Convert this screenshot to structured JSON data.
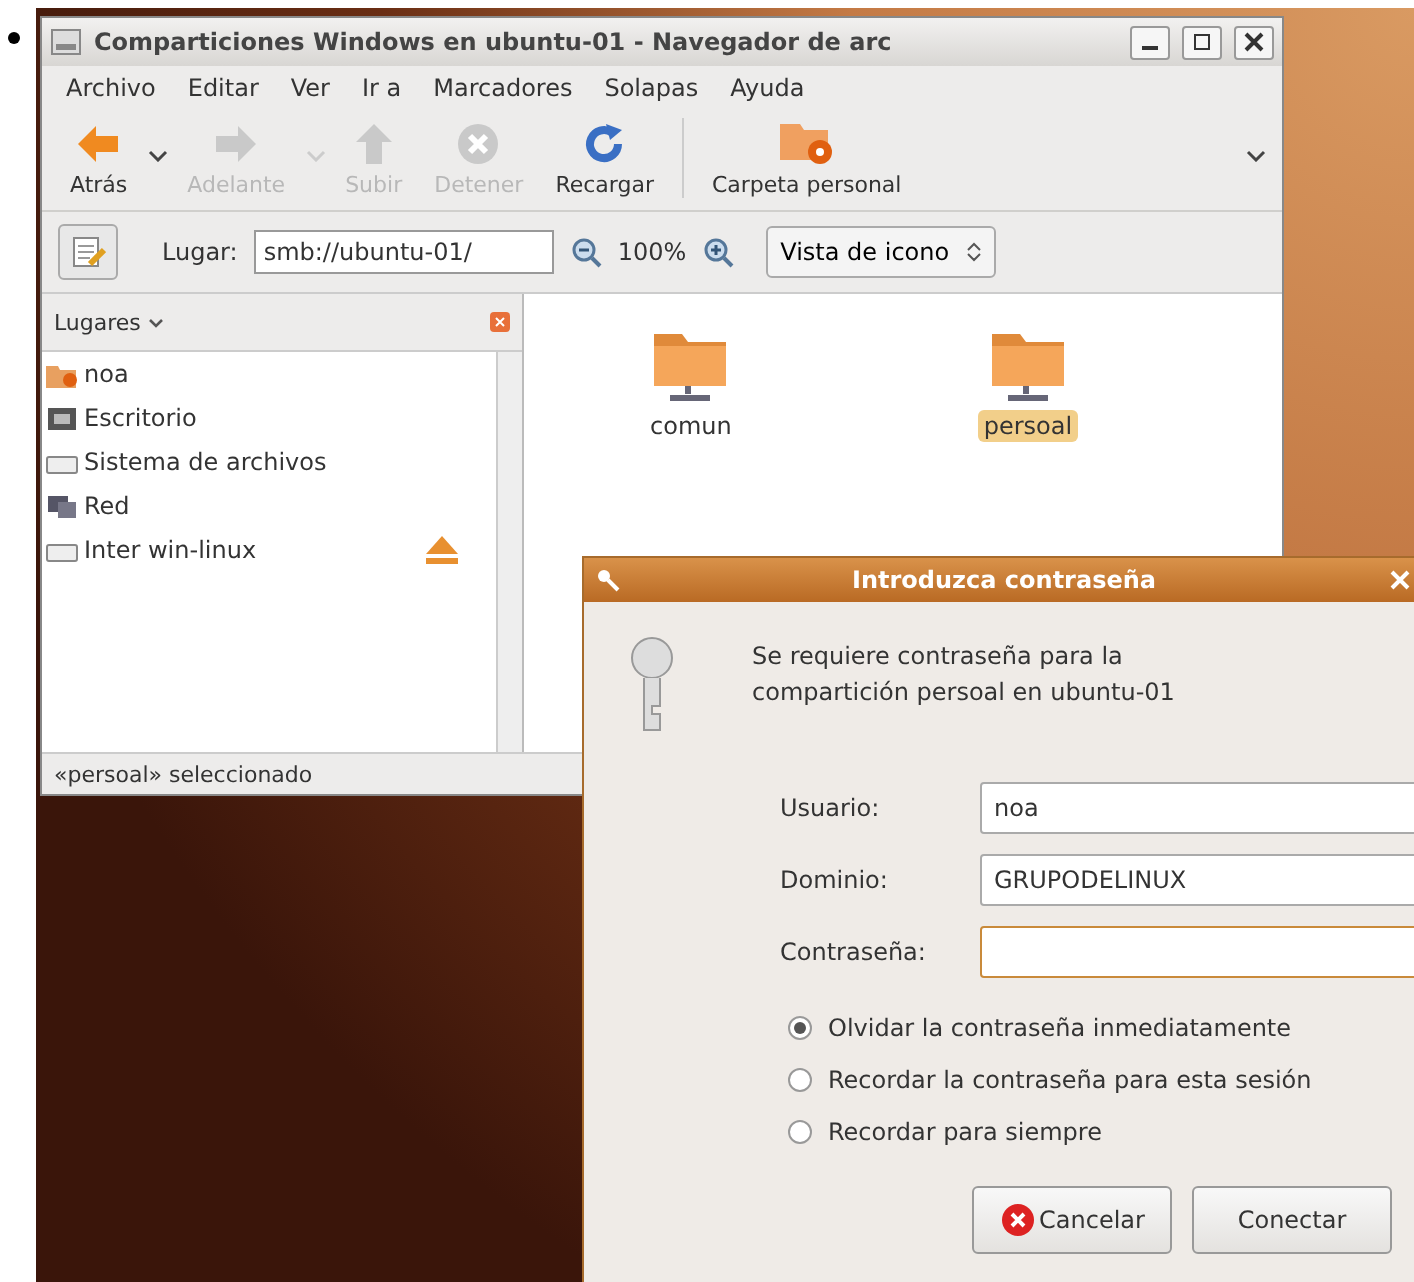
{
  "window": {
    "title": "Comparticiones Windows en ubuntu-01 - Navegador de arc"
  },
  "menu": [
    "Archivo",
    "Editar",
    "Ver",
    "Ir a",
    "Marcadores",
    "Solapas",
    "Ayuda"
  ],
  "toolbar": [
    {
      "label": "Atrás",
      "kind": "back",
      "disabled": false,
      "dropdown": true
    },
    {
      "label": "Adelante",
      "kind": "forward",
      "disabled": true,
      "dropdown": true
    },
    {
      "label": "Subir",
      "kind": "up",
      "disabled": true,
      "dropdown": false
    },
    {
      "label": "Detener",
      "kind": "stop",
      "disabled": true,
      "dropdown": false
    },
    {
      "label": "Recargar",
      "kind": "reload",
      "disabled": false,
      "dropdown": false
    },
    {
      "label": "Carpeta personal",
      "kind": "home",
      "disabled": false,
      "dropdown": false
    }
  ],
  "location": {
    "label": "Lugar:",
    "value": "smb://ubuntu-01/",
    "zoom": "100%",
    "view": "Vista de icono"
  },
  "sidebar": {
    "title": "Lugares",
    "items": [
      {
        "label": "noa",
        "kind": "home"
      },
      {
        "label": "Escritorio",
        "kind": "desktop"
      },
      {
        "label": "Sistema de archivos",
        "kind": "drive"
      },
      {
        "label": "Red",
        "kind": "network"
      },
      {
        "label": "Inter win-linux",
        "kind": "drive",
        "eject": true
      }
    ]
  },
  "files": [
    {
      "name": "comun",
      "selected": false
    },
    {
      "name": "persoal",
      "selected": true
    }
  ],
  "status": "«persoal» seleccionado",
  "dialog": {
    "title": "Introduzca contraseña",
    "message": "Se requiere contraseña para la compartición persoal en ubuntu-01",
    "fields": [
      {
        "label": "Usuario:",
        "value": "noa",
        "focused": false
      },
      {
        "label": "Dominio:",
        "value": "GRUPODELINUX",
        "focused": false
      },
      {
        "label": "Contraseña:",
        "focused": true
      }
    ],
    "options": [
      {
        "label": "Olvidar la contraseña inmediatamente",
        "selected": true
      },
      {
        "label": "Recordar la contraseña para esta sesión",
        "selected": false
      },
      {
        "label": "Recordar para siempre",
        "selected": false
      }
    ],
    "buttons": [
      {
        "label": "Cancelar",
        "kind": "cancel"
      },
      {
        "label": "Conectar",
        "kind": "ok"
      }
    ]
  }
}
